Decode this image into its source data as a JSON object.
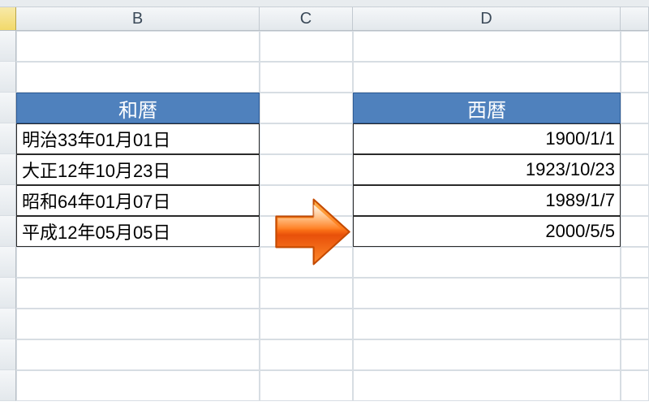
{
  "columns": {
    "B": "B",
    "C": "C",
    "D": "D"
  },
  "headers": {
    "wareki": "和暦",
    "seireki": "西暦"
  },
  "rows": [
    {
      "wareki": "明治33年01月01日",
      "seireki": "1900/1/1"
    },
    {
      "wareki": "大正12年10月23日",
      "seireki": "1923/10/23"
    },
    {
      "wareki": "昭和64年01月07日",
      "seireki": "1989/1/7"
    },
    {
      "wareki": "平成12年05月05日",
      "seireki": "2000/5/5"
    }
  ],
  "chart_data": {
    "type": "table",
    "title": "和暦 → 西暦",
    "columns": [
      "和暦",
      "西暦"
    ],
    "data": [
      [
        "明治33年01月01日",
        "1900/1/1"
      ],
      [
        "大正12年10月23日",
        "1923/10/23"
      ],
      [
        "昭和64年01月07日",
        "1989/1/7"
      ],
      [
        "平成12年05月05日",
        "2000/5/5"
      ]
    ]
  }
}
